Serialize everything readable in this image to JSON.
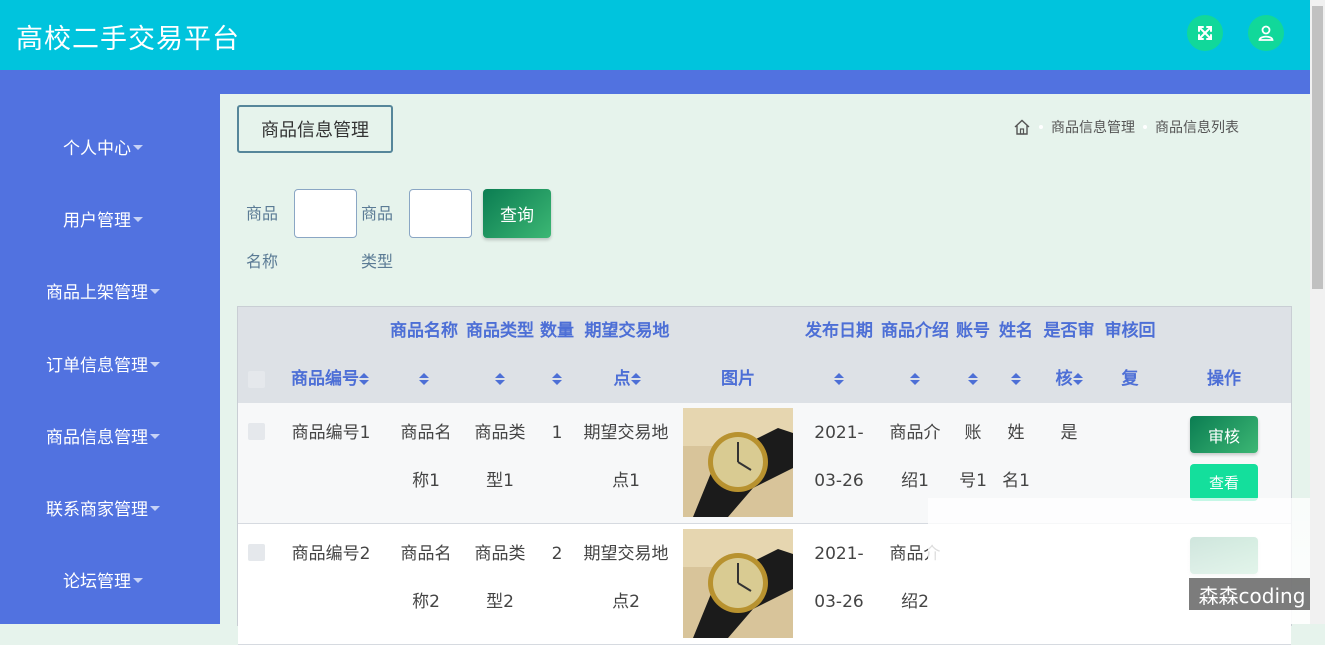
{
  "app": {
    "title": "高校二手交易平台"
  },
  "header_icons": [
    "fullscreen-icon",
    "user-icon"
  ],
  "sidebar": {
    "items": [
      {
        "label": "个人中心"
      },
      {
        "label": "用户管理"
      },
      {
        "label": "商品上架管理"
      },
      {
        "label": "订单信息管理"
      },
      {
        "label": "商品信息管理"
      },
      {
        "label": "联系商家管理"
      },
      {
        "label": "论坛管理"
      }
    ]
  },
  "page": {
    "tag": "商品信息管理",
    "breadcrumb": [
      "商品信息管理",
      "商品信息列表"
    ]
  },
  "search": {
    "name_label_1": "商品",
    "name_label_2": "名称",
    "name_value": "",
    "type_label_1": "商品",
    "type_label_2": "类型",
    "type_value": "",
    "query_label": "查询"
  },
  "table": {
    "headers": {
      "code": "商品编号",
      "name": "商品名称",
      "type": "商品类型",
      "qty": "数量",
      "place_1": "期望交易地",
      "place_2": "点",
      "image": "图片",
      "date": "发布日期",
      "intro": "商品介绍",
      "account": "账号",
      "person": "姓名",
      "audit_1": "是否审",
      "audit_2": "核",
      "reply_1": "审核回",
      "reply_2": "复",
      "ops": "操作"
    },
    "rows": [
      {
        "code": "商品编号1",
        "name_1": "商品名",
        "name_2": "称1",
        "type_1": "商品类",
        "type_2": "型1",
        "qty": "1",
        "place_1": "期望交易地",
        "place_2": "点1",
        "date_1": "2021-",
        "date_2": "03-26",
        "intro_1": "商品介",
        "intro_2": "绍1",
        "account_1": "账",
        "account_2": "号1",
        "person_1": "姓",
        "person_2": "名1",
        "audit": "是",
        "reply": "",
        "audit_btn": "审核",
        "view_btn": "查看"
      },
      {
        "code": "商品编号2",
        "name_1": "商品名",
        "name_2": "称2",
        "type_1": "商品类",
        "type_2": "型2",
        "qty": "2",
        "place_1": "期望交易地",
        "place_2": "点2",
        "date_1": "2021-",
        "date_2": "03-26",
        "intro_1": "商品介",
        "intro_2": "绍2",
        "account_1": "",
        "account_2": "",
        "person_1": "",
        "person_2": "",
        "audit": "",
        "reply": "",
        "audit_btn": "",
        "view_btn": ""
      }
    ]
  },
  "watermark": "森森coding",
  "colors": {
    "topbar": "#00c4dd",
    "sidebar": "#5172e0",
    "accent_green": "#14df9c",
    "header_text": "#4d6fd6",
    "content_bg": "#e6f3ec"
  }
}
